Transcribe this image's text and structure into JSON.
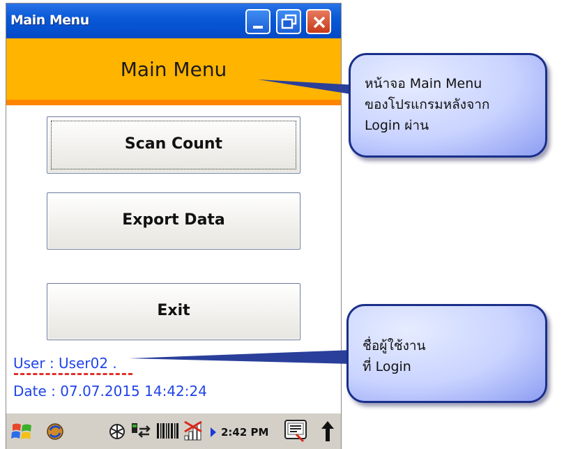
{
  "window": {
    "title": "Main Menu",
    "controls": {
      "minimize": "minimize-icon",
      "maximize": "restore-icon",
      "close": "close-icon"
    }
  },
  "header": {
    "title": "Main Menu",
    "band_color": "#ffb400",
    "stripe_color": "#ff8400"
  },
  "menu": {
    "scan_count": "Scan Count",
    "export_data": "Export Data",
    "exit": "Exit"
  },
  "info": {
    "user": "User : User02 .",
    "date": "Date : 07.07.2015 14:42:24",
    "text_color": "#2044e8"
  },
  "taskbar": {
    "clock": "2:42 PM",
    "icons": [
      "windows-start-icon",
      "sync-icon",
      "network-icon",
      "connection-icon",
      "barcode-icon",
      "signal-icon",
      "arrow-right-icon",
      "keyboard-icon",
      "up-arrow-icon"
    ]
  },
  "callouts": [
    {
      "lines": [
        "หน้าจอ Main Menu",
        "ของโปรแกรมหลังจาก",
        "Login ผ่าน"
      ]
    },
    {
      "lines": [
        "ชื่อผู้ใช้งาน",
        "ที่ Login"
      ]
    }
  ]
}
